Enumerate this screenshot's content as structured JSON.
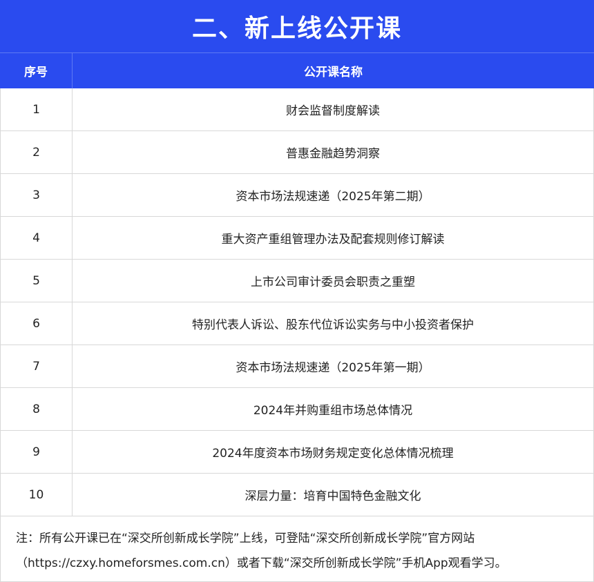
{
  "title": "二、新上线公开课",
  "table": {
    "headers": {
      "no": "序号",
      "name": "公开课名称"
    },
    "rows": [
      {
        "no": "1",
        "name": "财会监督制度解读"
      },
      {
        "no": "2",
        "name": "普惠金融趋势洞察"
      },
      {
        "no": "3",
        "name": "资本市场法规速递（2025年第二期）"
      },
      {
        "no": "4",
        "name": "重大资产重组管理办法及配套规则修订解读"
      },
      {
        "no": "5",
        "name": "上市公司审计委员会职责之重塑"
      },
      {
        "no": "6",
        "name": "特别代表人诉讼、股东代位诉讼实务与中小投资者保护"
      },
      {
        "no": "7",
        "name": "资本市场法规速递（2025年第一期）"
      },
      {
        "no": "8",
        "name": "2024年并购重组市场总体情况"
      },
      {
        "no": "9",
        "name": "2024年度资本市场财务规定变化总体情况梳理"
      },
      {
        "no": "10",
        "name": "深层力量：培育中国特色金融文化"
      }
    ]
  },
  "note": {
    "line1": "注：所有公开课已在“深交所创新成长学院”上线，可登陆“深交所创新成长学院”官方网站",
    "line2": "（https://czxy.homeforsmes.com.cn）或者下载“深交所创新成长学院”手机App观看学习。"
  },
  "colors": {
    "header_bg": "#2a4bef",
    "header_text": "#ffffff",
    "border": "#d8d8d8"
  }
}
